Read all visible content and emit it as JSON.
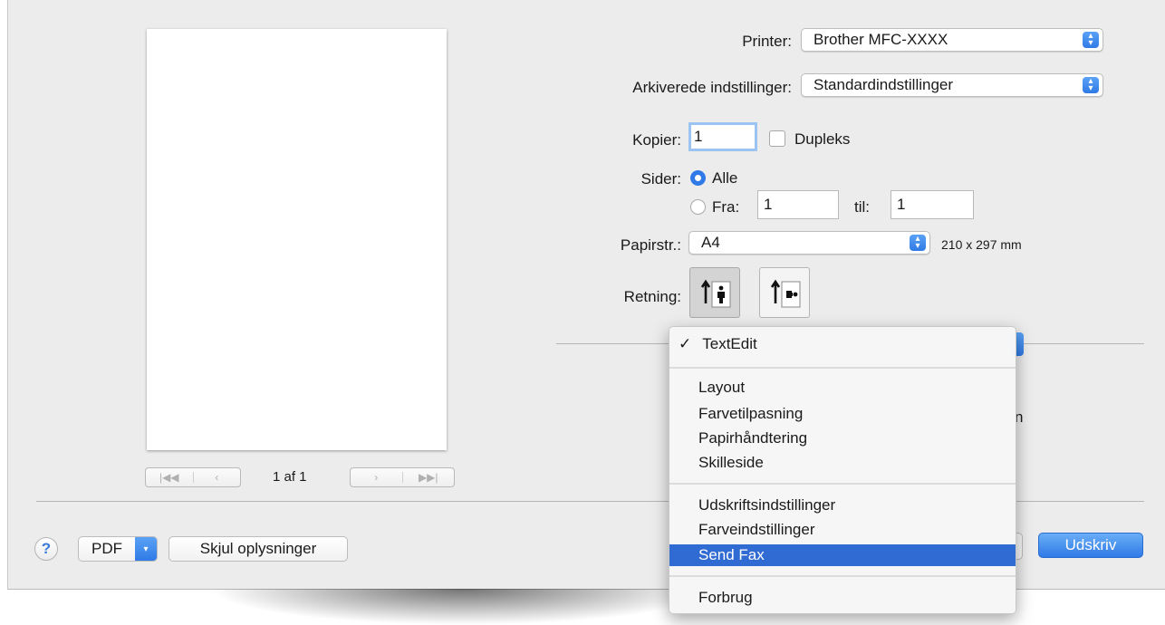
{
  "preview": {
    "page_counter": "1 af 1",
    "first_glyph": "|◀◀",
    "prev_glyph": "‹",
    "next_glyph": "›",
    "last_glyph": "▶▶|"
  },
  "printer": {
    "label": "Printer:",
    "value": "Brother MFC-XXXX"
  },
  "presets": {
    "label": "Arkiverede indstillinger:",
    "value": "Standardindstillinger"
  },
  "copies": {
    "label": "Kopier:",
    "value": "1",
    "duplex_label": "Dupleks",
    "duplex_checked": false
  },
  "pages": {
    "label": "Sider:",
    "all_label": "Alle",
    "from_label": "Fra:",
    "from_value": "1",
    "to_label": "til:",
    "to_value": "1",
    "selected": "all"
  },
  "paper": {
    "label": "Papirstr.:",
    "value": "A4",
    "dimensions": "210 x 297 mm"
  },
  "orientation": {
    "label": "Retning:",
    "selected": "portrait"
  },
  "menu": {
    "checked_item": "TextEdit",
    "check_glyph": "✓",
    "groups": [
      [
        "TextEdit"
      ],
      [
        "Layout",
        "Farvetilpasning",
        "Papirhåndtering",
        "Skilleside"
      ],
      [
        "Udskriftsindstillinger",
        "Farveindstillinger",
        "Send Fax"
      ],
      [
        "Forbrug"
      ]
    ],
    "highlighted": "Send Fax",
    "partial_text_behind": "n"
  },
  "footer": {
    "help_label": "?",
    "pdf_label": "PDF",
    "hide_details_label": "Skjul oplysninger",
    "print_label": "Udskriv"
  },
  "colors": {
    "accent": "#2f7ae6",
    "highlight": "#2f6bd2",
    "background": "#ececec"
  }
}
